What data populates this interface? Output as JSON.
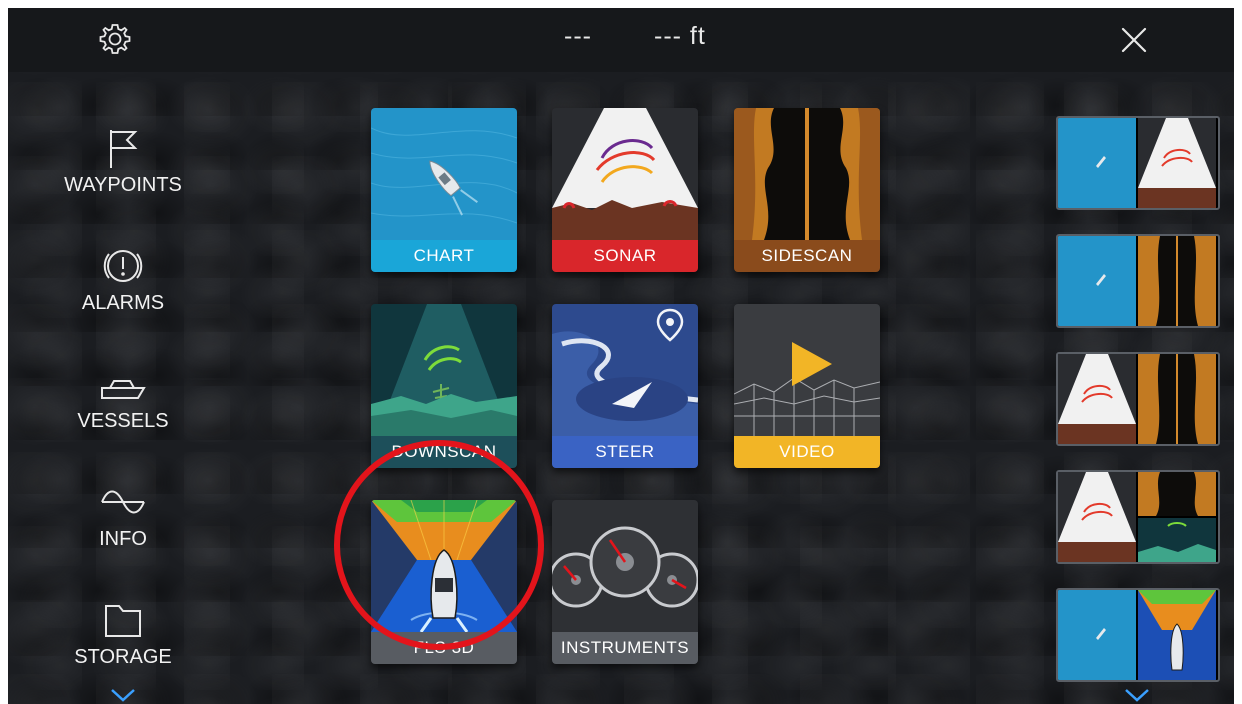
{
  "topbar": {
    "readout_primary": "---",
    "readout_secondary": "--- ft",
    "settings_icon": "gear-icon",
    "close_icon": "close-icon"
  },
  "sidebar": {
    "items": [
      {
        "label": "WAYPOINTS",
        "icon": "flag-icon"
      },
      {
        "label": "ALARMS",
        "icon": "alarm-icon"
      },
      {
        "label": "VESSELS",
        "icon": "boat-icon"
      },
      {
        "label": "INFO",
        "icon": "wave-icon"
      },
      {
        "label": "STORAGE",
        "icon": "folder-icon"
      }
    ],
    "more_icon": "chevron-down-icon"
  },
  "apps": [
    {
      "label": "CHART",
      "color": "#1aa6d8"
    },
    {
      "label": "SONAR",
      "color": "#d9262b"
    },
    {
      "label": "SIDESCAN",
      "color": "#8a4b1c"
    },
    {
      "label": "DOWNSCAN",
      "color": "#1d4f5a"
    },
    {
      "label": "STEER",
      "color": "#3a63c4"
    },
    {
      "label": "VIDEO",
      "color": "#f2b526"
    },
    {
      "label": "FLS 3D",
      "color": "#585c62"
    },
    {
      "label": "INSTRUMENTS",
      "color": "#585c62"
    }
  ],
  "highlight_color": "#e3141b",
  "presets": [
    {
      "left": "chart",
      "right": "sonar"
    },
    {
      "left": "chart",
      "right": "sidescan"
    },
    {
      "left": "sonar",
      "right": "sidescan"
    },
    {
      "left": "sonar",
      "right_top": "sidescan",
      "right_bottom": "downscan"
    },
    {
      "left": "chart",
      "right": "fls-3d"
    }
  ]
}
